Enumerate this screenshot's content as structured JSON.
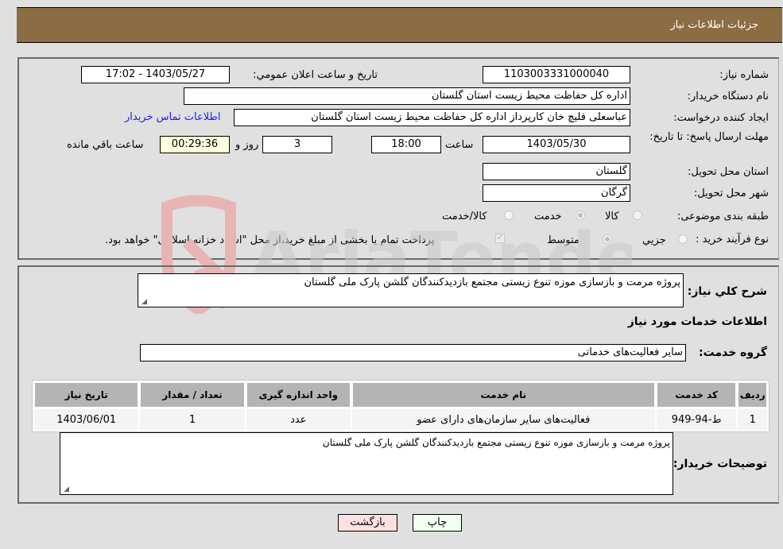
{
  "header": {
    "title": "جزئيات اطلاعات نياز"
  },
  "details": {
    "need_number": {
      "label": "شماره نياز:",
      "value": "1103003331000040"
    },
    "announce": {
      "label": "تاريخ و ساعت اعلان عمومي:",
      "value": "1403/05/27 - 17:02"
    },
    "buyer_org": {
      "label": "نام دستگاه خريدار:",
      "value": "اداره کل حفاظت محيط زيست استان گلستان"
    },
    "requester": {
      "label": "ايجاد کننده درخواست:",
      "value": "عباسعلی  قلیچ خان  کارپرداز اداره کل حفاظت محیط زیست استان گلستان"
    },
    "contact_link": "اطلاعات تماس خريدار",
    "deadline": {
      "label": "مهلت ارسال پاسخ: تا تاريخ:",
      "date": "1403/05/30",
      "time_label": "ساعت",
      "time": "18:00",
      "days": "3",
      "days_label": "روز و",
      "remaining": "00:29:36",
      "remaining_label": "ساعت باقي مانده"
    },
    "province": {
      "label": "استان محل تحويل:",
      "value": "گلستان"
    },
    "city": {
      "label": "شهر محل تحويل:",
      "value": "گرگان"
    },
    "category": {
      "label": "طبقه بندی موضوعی:",
      "options": [
        "کالا",
        "خدمت",
        "کالا/خدمت"
      ],
      "selected": "خدمت"
    },
    "process": {
      "label": "نوع فرآيند خريد :",
      "options": [
        "جزيي",
        "متوسط"
      ],
      "selected": "متوسط",
      "treasury_note": "پرداخت تمام يا بخشی از مبلغ خريد،از محل \"اسناد خزانه اسلامی\" خواهد بود."
    }
  },
  "summary": {
    "label": "شرح كلي نياز:",
    "value": "پروژه مرمت و بازسازی موزه تنوع زیستی مجتمع بازدیدکنندگان گلشن پارک ملی گلستان"
  },
  "services": {
    "title": "اطلاعات خدمات مورد نياز",
    "group_label": "گروه خدمت:",
    "group_value": "ساير فعاليت‌های خدماتی",
    "columns": [
      "رديف",
      "كد خدمت",
      "نام خدمت",
      "واحد اندازه گيری",
      "تعداد / مقدار",
      "تاريخ نياز"
    ],
    "rows": [
      [
        "1",
        "ط-94-949",
        "فعاليت‌های ساير سازمان‌های دارای عضو",
        "عدد",
        "1",
        "1403/06/01"
      ]
    ]
  },
  "buyer_notes": {
    "label": "توضيحات خريدار:",
    "value": "پروژه مرمت و بازسازی موزه تنوع زیستی مجتمع بازدیدکنندگان گلشن پارک ملی گلستان"
  },
  "buttons": {
    "print": "چاپ",
    "back": "بازگشت"
  },
  "colors": {
    "header": "#8b6c43",
    "print_bg": "#f0fff0",
    "back_bg": "#ffe0e0",
    "link": "#1a1aff"
  },
  "watermark": "AriaTender.neT"
}
